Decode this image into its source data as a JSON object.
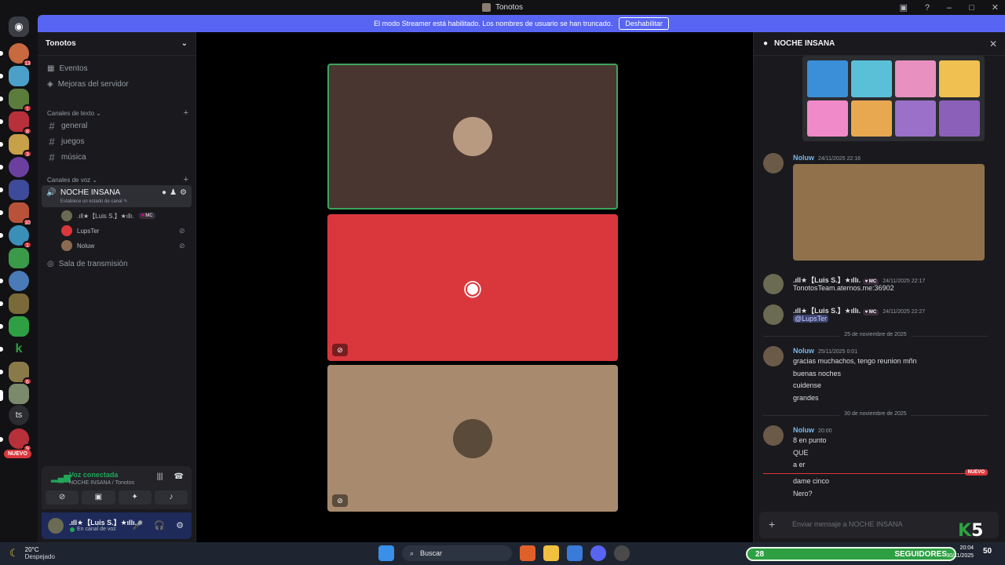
{
  "window": {
    "title": "Tonotos"
  },
  "banner": {
    "text": "El modo Streamer está habilitado. Los nombres de usuario se han truncado.",
    "button": "Deshabilitar"
  },
  "rail": {
    "badges": [
      "13",
      "1",
      "8",
      "3",
      "10",
      "1",
      "6",
      "9"
    ],
    "ts_label": "ts",
    "new_label": "NUEVO"
  },
  "sidebar": {
    "guild_name": "Tonotos",
    "events": "Eventos",
    "boosts": "Mejoras del servidor",
    "text_category": "Canales de texto",
    "text_channels": [
      "general",
      "juegos",
      "música"
    ],
    "voice_category": "Canales de voz",
    "voice_channel": {
      "name": "NOCHE INSANA",
      "status": "Establece un estado de canal"
    },
    "voice_users": [
      {
        "name": ".ıll★【Luis S.】★ıllı.",
        "tag": "MC"
      },
      {
        "name": "LupsTer"
      },
      {
        "name": "Noluw"
      }
    ],
    "stage_channel": "Sala de transmisión"
  },
  "voice_panel": {
    "title": "Voz conectada",
    "subtitle": "NOCHE INSANA / Tonotos"
  },
  "user": {
    "name": ".ıll★【Luis S.】★ıllı.",
    "status": "En canal de voz"
  },
  "chat": {
    "title": "NOCHE INSANA",
    "messages": [
      {
        "author": "Noluw",
        "time": "24/11/2025 22:16"
      },
      {
        "author": ".ıll★【Luis S.】★ıllı.",
        "tag": "MC",
        "time": "24/11/2025 22:17",
        "text": "TonotosTeam.aternos.me:36902"
      },
      {
        "author": ".ıll★【Luis S.】★ıllı.",
        "tag": "MC",
        "time": "24/11/2025 22:27",
        "text": "@LupsTer"
      }
    ],
    "divider1": "25 de noviembre de 2025",
    "msg2": {
      "author": "Noluw",
      "time": "25/11/2025 0:01",
      "lines": [
        "gracias muchachos, tengo reunion mñn",
        "buenas noches",
        "cuidense",
        "grandes"
      ]
    },
    "divider2": "30 de noviembre de 2025",
    "msg3": {
      "author": "Noluw",
      "time": "20:00",
      "lines": [
        "8 en punto",
        "QUE",
        "a er",
        "dame cinco",
        "Nero?"
      ]
    },
    "new_label": "NUEVO",
    "input_placeholder": "Enviar mensaje a NOCHE INSANA"
  },
  "taskbar": {
    "temp": "20°C",
    "weather": "Despejado",
    "search": "Buscar",
    "followers_count": "28",
    "followers_label": "SEGUIDORES",
    "time": "20:04",
    "date": "30/11/2025",
    "overlay_k": "K",
    "overlay_5": "5",
    "overlay_50": "50"
  },
  "colors": {
    "accent": "#5865f2",
    "online": "#23a55a",
    "alert": "#da373c"
  }
}
